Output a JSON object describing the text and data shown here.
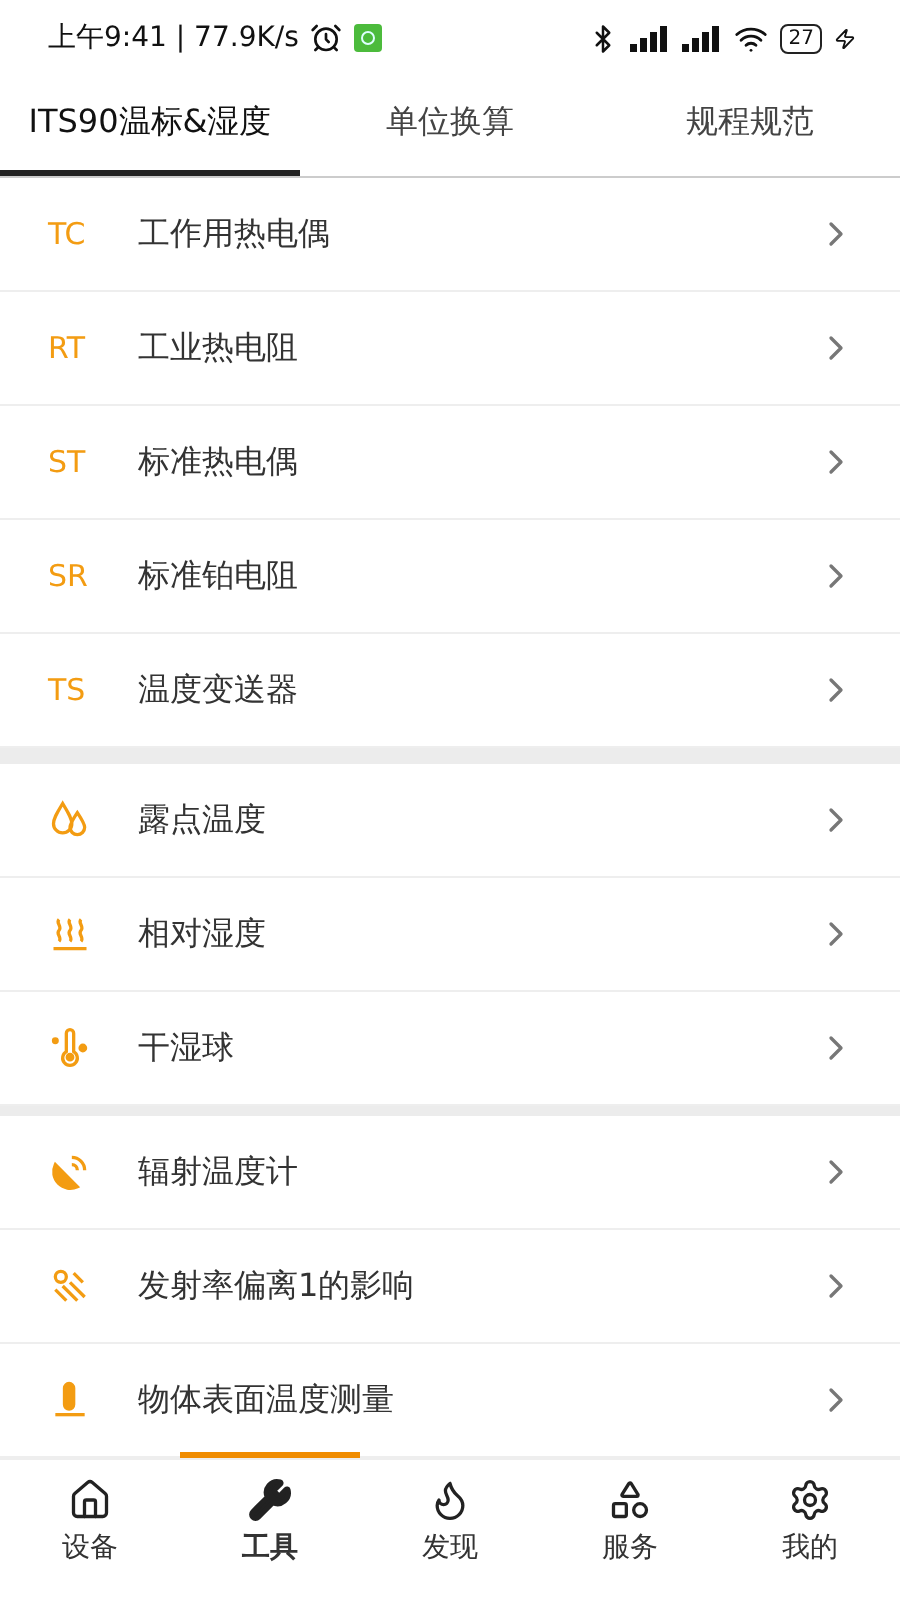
{
  "status_bar": {
    "time": "上午9:41 | 77.9K/s",
    "battery": "27"
  },
  "tabs": [
    {
      "label": "ITS90温标&湿度",
      "selected": true
    },
    {
      "label": "单位换算",
      "selected": false
    },
    {
      "label": "规程规范",
      "selected": false
    }
  ],
  "sections": [
    {
      "items": [
        {
          "kind": "code",
          "code": "TC",
          "label": "工作用热电偶"
        },
        {
          "kind": "code",
          "code": "RT",
          "label": "工业热电阻"
        },
        {
          "kind": "code",
          "code": "ST",
          "label": "标准热电偶"
        },
        {
          "kind": "code",
          "code": "SR",
          "label": "标准铂电阻"
        },
        {
          "kind": "code",
          "code": "TS",
          "label": "温度变送器"
        }
      ]
    },
    {
      "items": [
        {
          "kind": "icon",
          "label": "露点温度"
        },
        {
          "kind": "icon",
          "label": "相对湿度"
        },
        {
          "kind": "icon",
          "label": "干湿球"
        }
      ]
    },
    {
      "items": [
        {
          "kind": "icon",
          "label": "辐射温度计"
        },
        {
          "kind": "icon",
          "label": "发射率偏离1的影响"
        },
        {
          "kind": "icon",
          "label": "物体表面温度测量"
        }
      ]
    }
  ],
  "bottom_nav": [
    {
      "label": "设备",
      "selected": false
    },
    {
      "label": "工具",
      "selected": true
    },
    {
      "label": "发现",
      "selected": false
    },
    {
      "label": "服务",
      "selected": false
    },
    {
      "label": "我的",
      "selected": false
    }
  ]
}
